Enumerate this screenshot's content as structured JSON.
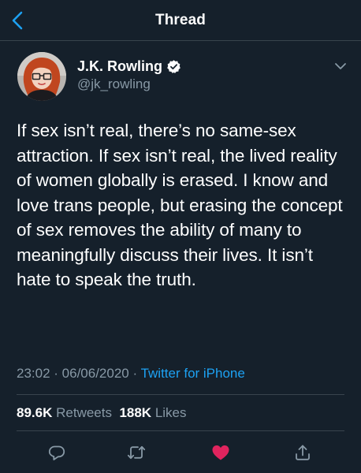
{
  "header": {
    "title": "Thread",
    "back_icon": "chevron-left-icon"
  },
  "tweet": {
    "author_name": "J.K. Rowling",
    "handle": "@jk_rowling",
    "verified": true,
    "text": "If sex isn’t real, there’s no same-sex attraction. If sex isn’t real, the lived reality of women globally is erased. I know and love trans people, but erasing the concept of sex removes the ability of many to meaningfully discuss their lives. It isn’t hate to speak the truth.",
    "time": "23:02",
    "separator": " · ",
    "date": "06/06/2020",
    "source": "Twitter for iPhone",
    "retweets_count": "89.6K",
    "retweets_label": "Retweets",
    "likes_count": "188K",
    "likes_label": "Likes",
    "liked": true
  },
  "actions": [
    {
      "name": "reply-icon"
    },
    {
      "name": "retweet-icon"
    },
    {
      "name": "like-icon"
    },
    {
      "name": "share-icon"
    }
  ],
  "colors": {
    "background": "#15202b",
    "divider": "#38444d",
    "secondary_text": "#8899a6",
    "accent": "#1da1f2",
    "like": "#e0245e",
    "primary_text": "#ffffff"
  }
}
